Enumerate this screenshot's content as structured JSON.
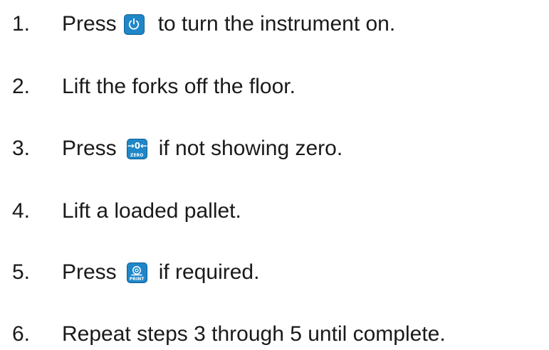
{
  "steps": [
    {
      "number": "1.",
      "before": "Press",
      "key": "power",
      "after": "to turn the instrument on."
    },
    {
      "number": "2.",
      "text": "Lift the forks off the floor."
    },
    {
      "number": "3.",
      "before": "Press",
      "key": "zero",
      "after": "if not showing zero."
    },
    {
      "number": "4.",
      "text": "Lift a loaded pallet."
    },
    {
      "number": "5.",
      "before": "Press",
      "key": "print",
      "after": "if required."
    },
    {
      "number": "6.",
      "text": "Repeat steps 3 through 5 until complete."
    }
  ],
  "keys": {
    "power": {
      "icon": "power-icon"
    },
    "zero": {
      "icon": "zero-icon",
      "glyph": "→0←",
      "label": "ZERO"
    },
    "print": {
      "icon": "print-icon",
      "label": "PRINT"
    }
  },
  "colors": {
    "text": "#1a1a1a",
    "key_fill": "#1f86c8",
    "key_border": "#0e5f93",
    "key_symbol": "#ffffff"
  }
}
